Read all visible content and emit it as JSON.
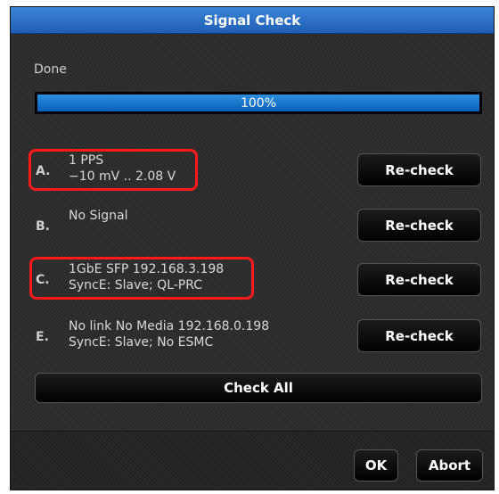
{
  "dialog": {
    "title": "Signal Check",
    "status": "Done",
    "progress": {
      "value": 100,
      "label": "100%"
    }
  },
  "rows": [
    {
      "letter": "A.",
      "line1": "1 PPS",
      "line2": "−10 mV .. 2.08 V",
      "button": "Re-check",
      "highlighted": true
    },
    {
      "letter": "B.",
      "line1": "No Signal",
      "line2": "",
      "button": "Re-check",
      "highlighted": false
    },
    {
      "letter": "C.",
      "line1": "1GbE SFP  192.168.3.198",
      "line2": "SyncE: Slave; QL-PRC",
      "button": "Re-check",
      "highlighted": true
    },
    {
      "letter": "E.",
      "line1": "No link No Media  192.168.0.198",
      "line2": "SyncE: Slave; No ESMC",
      "button": "Re-check",
      "highlighted": false
    }
  ],
  "actions": {
    "check_all": "Check All",
    "ok": "OK",
    "abort": "Abort"
  },
  "colors": {
    "titlebar": "#2f74c9",
    "highlight": "#ff1a1a",
    "progress_fill": "#1a78d0"
  }
}
